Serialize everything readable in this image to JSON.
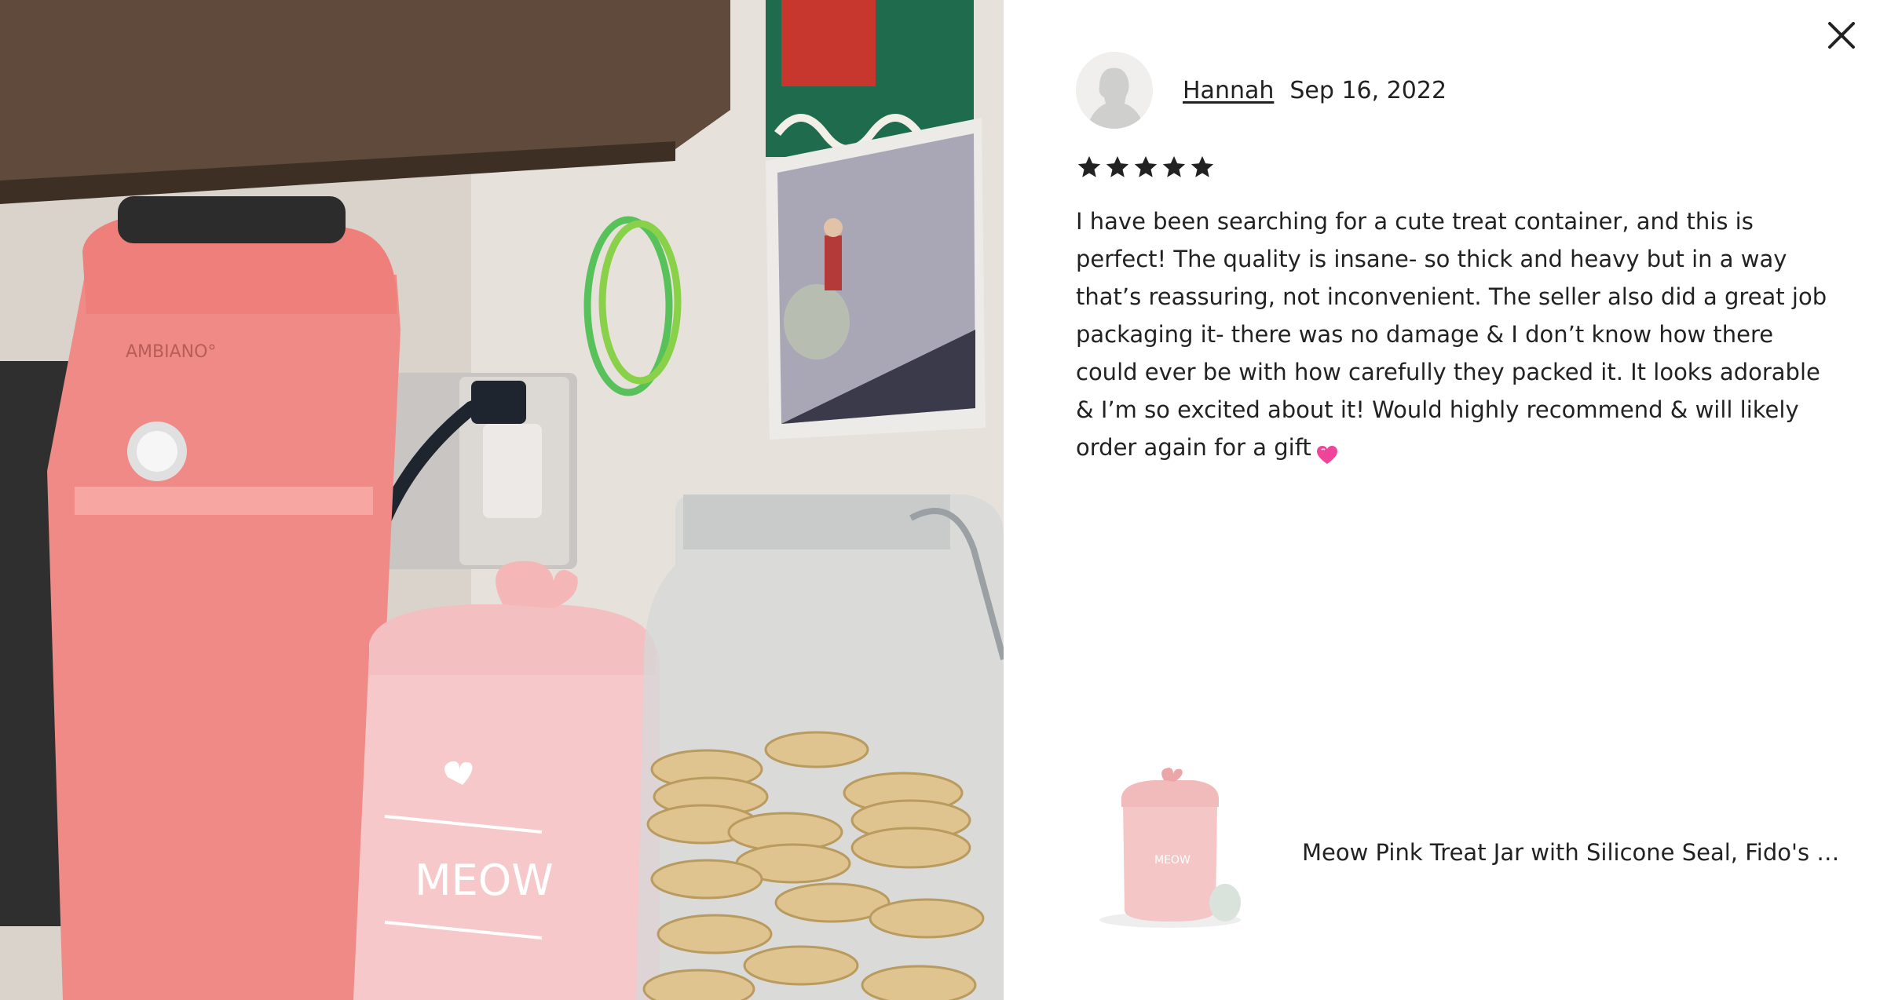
{
  "photo": {
    "jar_label": "MEOW",
    "appliance_brand": "AMBIANO°"
  },
  "close": {
    "icon": "close-icon"
  },
  "reviewer": {
    "name": "Hannah",
    "date": "Sep 16, 2022",
    "avatar_icon": "default-avatar"
  },
  "rating": {
    "value": 5,
    "max": 5,
    "icon": "star-icon"
  },
  "review": {
    "text": "I have been searching for a cute treat container, and this is perfect! The quality is insane- so thick and heavy but in a way that’s reassuring, not inconvenient. The seller also did a great job packaging it- there was no damage & I don’t know how there could ever be with how carefully they packed it. It looks adorable & I’m so excited about it! Would highly recommend & will likely order again for a gift",
    "emoji": "💗"
  },
  "product": {
    "title": "Meow Pink Treat Jar with Silicone Seal, Fido's Diner...",
    "thumb_label": "MEOW"
  },
  "colors": {
    "text": "#222222",
    "star": "#222222",
    "jar_pink": "#f6c8c9",
    "appliance_pink": "#f08a86"
  }
}
